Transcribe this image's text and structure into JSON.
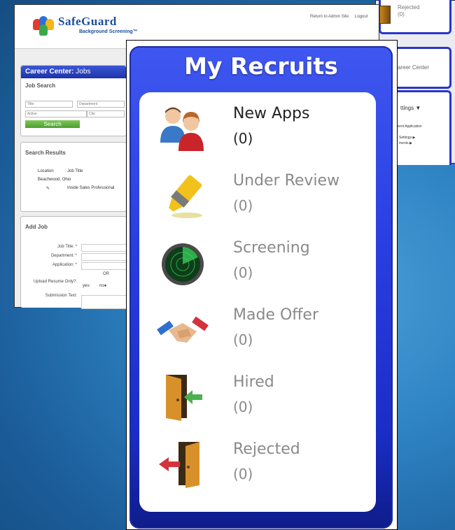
{
  "back_right": {
    "rejected_label": "Rejected",
    "rejected_count": "(0)",
    "career_center_label": "areer Center",
    "settings_label": "ttings ▼",
    "settings_item_1": "ment Application",
    "settings_item_2": "Settings ▶",
    "settings_item_3": "ments ▶"
  },
  "back_left": {
    "logo_name": "SafeGuard",
    "logo_sub": "Background Screening™",
    "link_admin": "Return to Admin Site",
    "link_logout": "Logout",
    "career_center": "Career Center:",
    "career_center_page": "Jobs",
    "job_search": "Job Search",
    "fields": {
      "title": "Title",
      "department": "Department",
      "status": "Active",
      "city": "City"
    },
    "search_button": "Search",
    "search_results": "Search Results",
    "columns": {
      "location": "Location",
      "job_title": "Job Title"
    },
    "result_location": "Beachwood, Ohio",
    "result_job": "Inside Sales Professional",
    "add_job": "Add Job",
    "form": {
      "job_title": "Job Title: *",
      "department": "Department: *",
      "application": "Application: *",
      "or": "OR",
      "upload_resume": "Upload Resume Only?:",
      "yes": "yes",
      "no": "no",
      "submission_text": "Submission Text:"
    }
  },
  "recruits": {
    "title": "My Recruits",
    "items": [
      {
        "label": "New Apps",
        "count": "(0)",
        "icon": "people-icon",
        "active": true
      },
      {
        "label": "Under Review",
        "count": "(0)",
        "icon": "highlighter-icon",
        "active": false
      },
      {
        "label": "Screening",
        "count": "(0)",
        "icon": "radar-icon",
        "active": false
      },
      {
        "label": "Made Offer",
        "count": "(0)",
        "icon": "handshake-icon",
        "active": false
      },
      {
        "label": "Hired",
        "count": "(0)",
        "icon": "door-enter-icon",
        "active": false
      },
      {
        "label": "Rejected",
        "count": "(0)",
        "icon": "door-exit-icon",
        "active": false
      }
    ]
  },
  "colors": {
    "frame_blue": "#2a3fe0",
    "title_bar_blue": "#1e33a8",
    "search_green": "#4e9d2e",
    "active_text": "#222222",
    "inactive_text": "#8a8a8a"
  }
}
